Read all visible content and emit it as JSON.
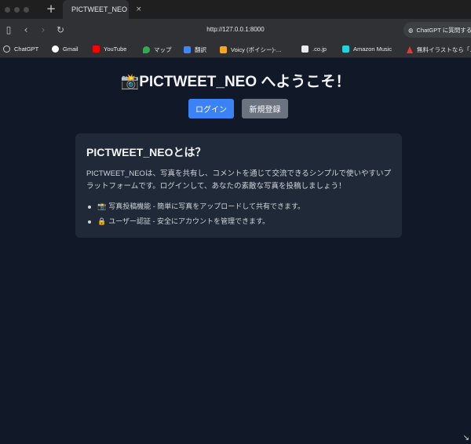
{
  "browser": {
    "tab_title": "PICTWEET_NEO",
    "new_tab": "+",
    "tab_close": "×",
    "url": "http://127.0.0.1:8000",
    "gpt_pill": "ChatGPT に質問する…",
    "bookmarks": [
      {
        "label": "ChatGPT",
        "color": "#9ca3af"
      },
      {
        "label": "Gmail",
        "color": "#ea4335"
      },
      {
        "label": "YouTube",
        "color": "#ff0000"
      },
      {
        "label": "マップ",
        "color": "#34a853"
      },
      {
        "label": "翻訳",
        "color": "#4285f4"
      },
      {
        "label": "Voicy (ボイシー)-…",
        "color": "#f5a623"
      },
      {
        "label": ".co.jp",
        "color": "#e8eaed"
      },
      {
        "label": "Amazon Music",
        "color": "#25d1da"
      },
      {
        "label": "無料イラストなら「…",
        "color": "#e53935"
      }
    ]
  },
  "page": {
    "title_icon": "📸",
    "title": "PICTWEET_NEO へようこそ！",
    "login_button": "ログイン",
    "register_button": "新規登録",
    "card": {
      "heading": "PICTWEET_NEOとは？",
      "description": "PICTWEET_NEOは、写真を共有し、コメントを通じて交流できるシンプルで使いやすいプラットフォームです。ログインして、あなたの素敵な写真を投稿しましょう！",
      "features": [
        {
          "icon": "📸",
          "text": "写真投稿機能 - 簡単に写真をアップロードして共有できます。"
        },
        {
          "icon": "🔒",
          "text": "ユーザー認証 - 安全にアカウントを管理できます。"
        }
      ]
    }
  },
  "colors": {
    "background": "#111827",
    "card": "#1f2937",
    "primary": "#3b82f6",
    "secondary": "#6b7280"
  }
}
